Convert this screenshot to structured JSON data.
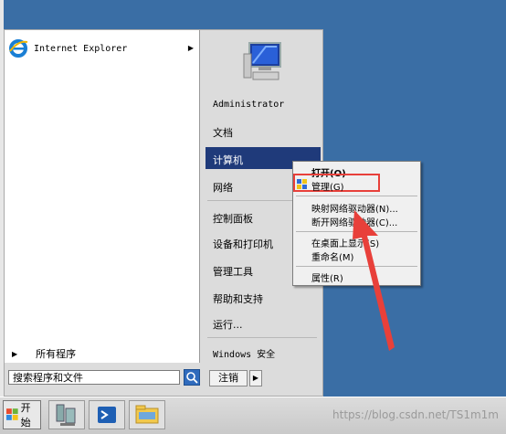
{
  "start_menu": {
    "pinned": [
      {
        "label": "Internet Explorer",
        "has_submenu": true,
        "icon": "ie-icon"
      }
    ],
    "all_programs_label": "所有程序",
    "search_placeholder": "搜索程序和文件",
    "right_items": {
      "user": "Administrator",
      "documents": "文档",
      "computer": "计算机",
      "network": "网络",
      "control_panel": "控制面板",
      "devices_printers": "设备和打印机",
      "admin_tools": "管理工具",
      "help_support": "帮助和支持",
      "run": "运行...",
      "windows_security": "Windows 安全"
    },
    "logout_label": "注销"
  },
  "context_menu": {
    "items": {
      "open": "打开(O)",
      "manage": "管理(G)",
      "map_drive": "映射网络驱动器(N)...",
      "disconnect_drive": "断开网络驱动器(C)...",
      "show_on_desktop": "在桌面上显示(S)",
      "rename": "重命名(M)",
      "properties": "属性(R)"
    },
    "highlight_color": "#e8403a"
  },
  "taskbar": {
    "start_label": "开始",
    "buttons": [
      "server-manager-icon",
      "powershell-icon",
      "explorer-folder-icon"
    ],
    "watermark": "https://blog.csdn.net/TS1m1m"
  },
  "colors": {
    "desktop": "#3a6ea5",
    "selection": "#1f3a7a",
    "annotation": "#e8403a"
  }
}
